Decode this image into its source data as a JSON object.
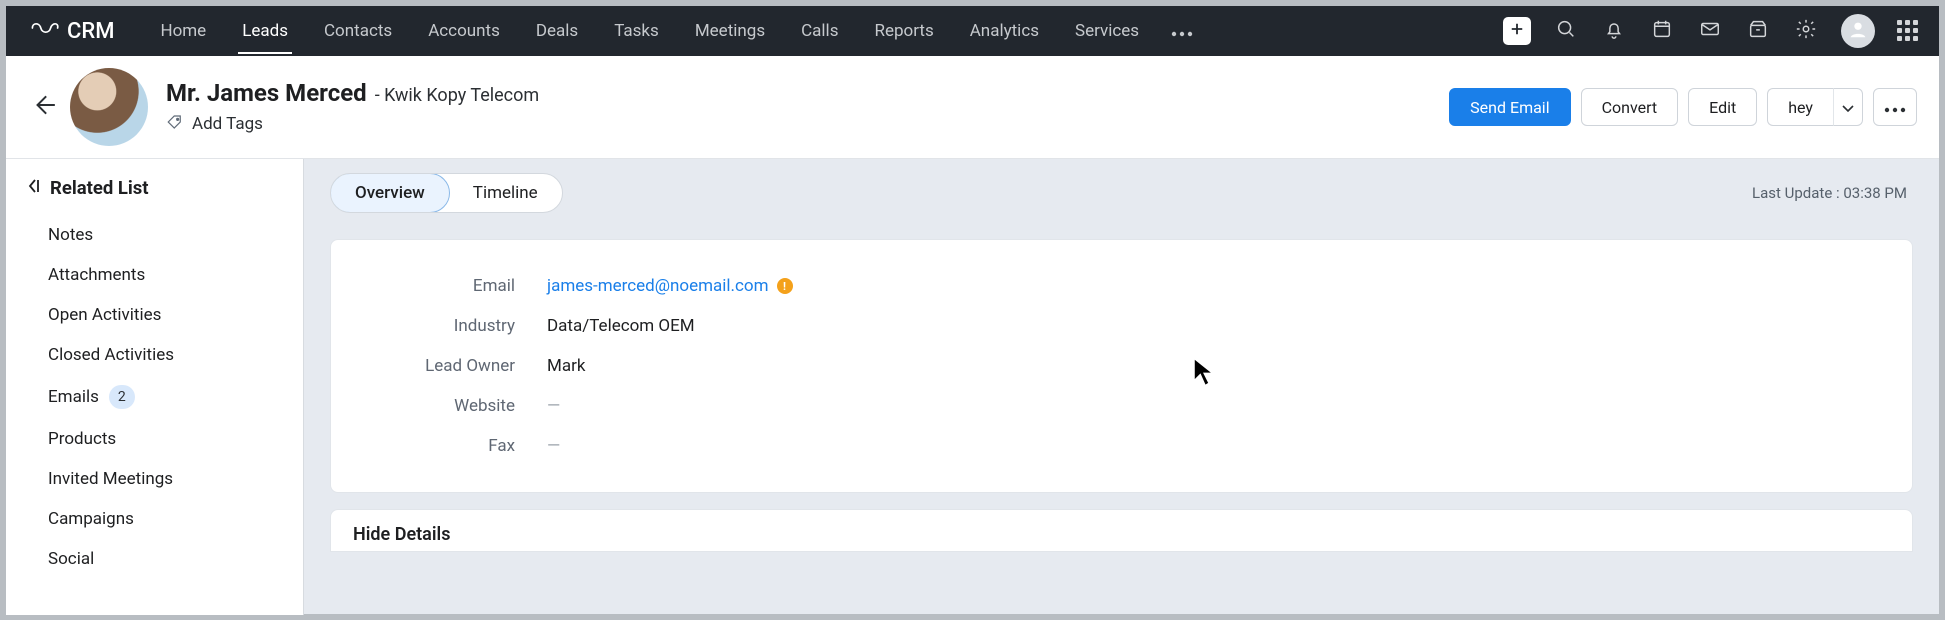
{
  "brand": "CRM",
  "nav": {
    "items": [
      "Home",
      "Leads",
      "Contacts",
      "Accounts",
      "Deals",
      "Tasks",
      "Meetings",
      "Calls",
      "Reports",
      "Analytics",
      "Services"
    ]
  },
  "record": {
    "title_prefix": "Mr. James Merced",
    "subtitle": "- Kwik Kopy Telecom",
    "add_tags": "Add Tags"
  },
  "actions": {
    "send_email": "Send Email",
    "convert": "Convert",
    "edit": "Edit",
    "custom": "hey"
  },
  "sidebar": {
    "title": "Related List",
    "items": [
      "Notes",
      "Attachments",
      "Open Activities",
      "Closed Activities",
      "Emails",
      "Products",
      "Invited Meetings",
      "Campaigns",
      "Social"
    ],
    "emails_badge": "2"
  },
  "tabs": {
    "overview": "Overview",
    "timeline": "Timeline"
  },
  "last_update": "Last Update : 03:38 PM",
  "fields": {
    "email_label": "Email",
    "email_value": "james-merced@noemail.com",
    "industry_label": "Industry",
    "industry_value": "Data/Telecom OEM",
    "owner_label": "Lead Owner",
    "owner_value": "Mark",
    "website_label": "Website",
    "website_value": "—",
    "fax_label": "Fax",
    "fax_value": "—"
  },
  "hide_details": "Hide Details"
}
